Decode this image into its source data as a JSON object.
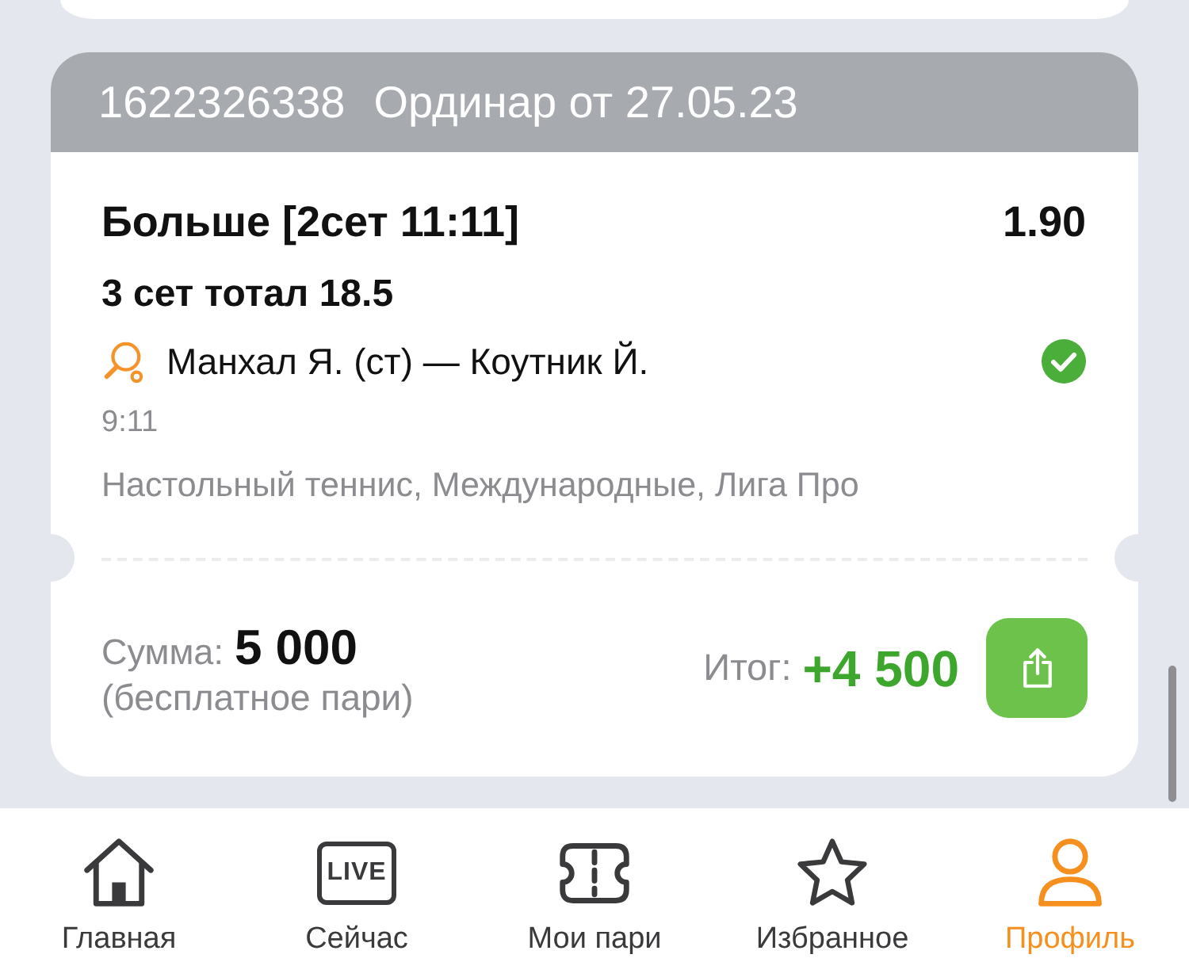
{
  "bet": {
    "id": "1622326338",
    "type": "Ординар от 27.05.23",
    "selection": "Больше [2сет 11:11]",
    "odds": "1.90",
    "market": "3 сет тотал 18.5",
    "event": "Манхал Я. (ст) — Коутник Й.",
    "won": true,
    "time": "9:11",
    "league": "Настольный теннис, Международные, Лига Про",
    "stake_label": "Сумма:",
    "stake": "5 000",
    "stake_note": "(бесплатное пари)",
    "result_label": "Итог:",
    "result": "+4 500"
  },
  "tab_bar": [
    {
      "label": "Главная",
      "kind": "home",
      "selected": false
    },
    {
      "label": "Сейчас",
      "kind": "live",
      "badge": "LIVE",
      "selected": false
    },
    {
      "label": "Мои пари",
      "kind": "ticket",
      "selected": false
    },
    {
      "label": "Избранное",
      "kind": "star",
      "selected": false
    },
    {
      "label": "Профиль",
      "kind": "person",
      "selected": true
    }
  ]
}
